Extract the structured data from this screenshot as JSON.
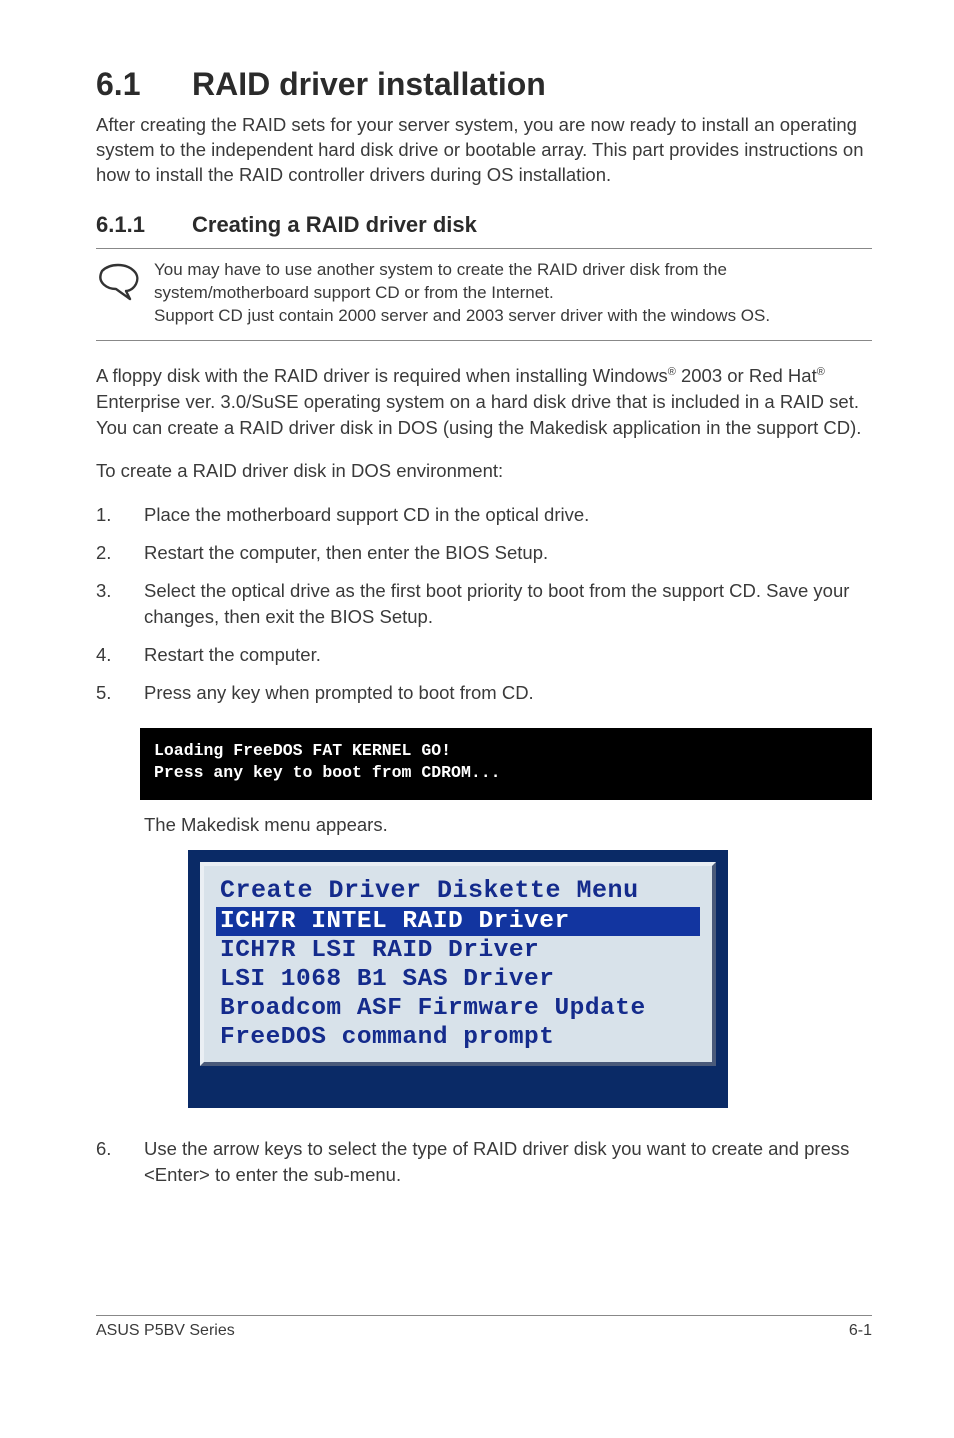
{
  "section": {
    "number": "6.1",
    "title": "RAID driver installation"
  },
  "intro": "After creating the RAID sets for your server system, you are now ready to install an operating system to the independent hard disk drive or bootable array. This part provides instructions on how to install the RAID controller drivers during OS installation.",
  "subsection": {
    "number": "6.1.1",
    "title": "Creating a RAID driver disk"
  },
  "note": {
    "line1": "You may have to use another system to create the RAID driver disk from the system/motherboard support CD or from the Internet.",
    "line2": "Support CD just contain 2000 server and 2003 server driver with the windows OS."
  },
  "floppy": {
    "pre1": "A floppy disk with the RAID driver is required when installing Windows",
    "sup1": "®",
    "mid1": " 2003 or Red Hat",
    "sup2": "®",
    "post1": " Enterprise ver. 3.0/SuSE operating system on a hard disk drive that is included in a RAID set. You can create a RAID driver disk in DOS (using the Makedisk application in the support CD)."
  },
  "leadin": "To create a RAID driver disk in DOS environment:",
  "steps": [
    "Place the motherboard support CD in the optical drive.",
    "Restart the computer, then enter the BIOS Setup.",
    "Select the optical drive as the first boot priority to boot from the support CD. Save your changes, then exit the BIOS Setup.",
    "Restart the computer.",
    "Press any key when prompted to boot from CD."
  ],
  "code": "Loading FreeDOS FAT KERNEL GO!\nPress any key to boot from CDROM...",
  "caption": "The Makedisk menu appears.",
  "menu": {
    "title": "Create Driver Diskette Menu",
    "items": [
      {
        "label": "ICH7R INTEL RAID Driver",
        "highlight": true
      },
      {
        "label": "ICH7R LSI RAID Driver",
        "highlight": false
      },
      {
        "label": "LSI 1068 B1 SAS Driver",
        "highlight": false
      },
      {
        "label": "Broadcom ASF Firmware Update",
        "highlight": false
      },
      {
        "label": "FreeDOS command prompt",
        "highlight": false
      }
    ]
  },
  "step6": {
    "num": "6.",
    "text": "Use the arrow keys to select the type of  RAID driver disk you want to create and press <Enter> to enter the sub-menu."
  },
  "footer": {
    "left": "ASUS P5BV Series",
    "right": "6-1"
  }
}
